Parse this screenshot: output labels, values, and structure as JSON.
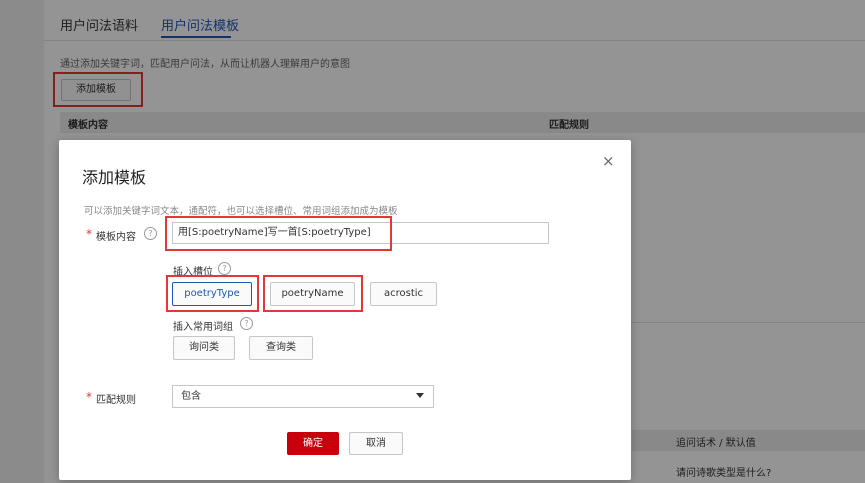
{
  "tabs": [
    {
      "label": "用户问法语料",
      "active": false
    },
    {
      "label": "用户问法模板",
      "active": true
    }
  ],
  "page": {
    "description": "通过添加关键字词，匹配用户问法，从而让机器人理解用户的意图",
    "add_button": "添加模板",
    "table": {
      "col_template": "模板内容",
      "col_rule": "匹配规则"
    },
    "slot_table": {
      "col_followup": "追问话术 / 默认值",
      "row_followup": "请问诗歌类型是什么?"
    }
  },
  "dialog": {
    "title": "添加模板",
    "close": "×",
    "description": "可以添加关键字词文本，通配符，也可以选择槽位、常用词组添加成为模板",
    "template_label": "模板内容",
    "template_value": "用[S:poetryName]写一首[S:poetryType]",
    "insert_slot_label": "插入槽位",
    "slots": [
      "poetryType",
      "poetryName",
      "acrostic"
    ],
    "insert_phrase_label": "插入常用词组",
    "phrases": [
      "询问类",
      "查询类"
    ],
    "match_rule_label": "匹配规则",
    "match_rule_value": "包含",
    "ok": "确定",
    "cancel": "取消",
    "required_mark": "*",
    "help_mark": "?"
  },
  "colors": {
    "accent": "#1f56b6",
    "highlight": "#e33838",
    "primary_button": "#c7000b"
  }
}
